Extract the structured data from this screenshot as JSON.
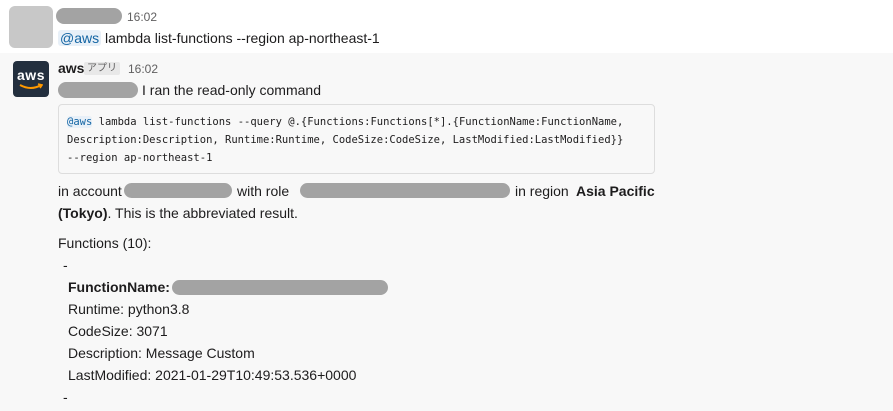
{
  "message1": {
    "time": "16:02",
    "mention": "@aws",
    "command_text": " lambda list-functions --region ap-northeast-1"
  },
  "message2": {
    "sender": "aws",
    "badge": "アプリ",
    "time": "16:02",
    "intro": "I ran the read-only command",
    "code": {
      "mention": "@aws",
      "line1_rest": " lambda list-functions --query @.{Functions:Functions[*].{FunctionName:FunctionName,",
      "line2": "Description:Description, Runtime:Runtime, CodeSize:CodeSize, LastModified:LastModified}}",
      "line3": "--region ap-northeast-1"
    },
    "account_prefix": "in account",
    "role_text": "with role",
    "region_text": "in region",
    "region_bold_1": "Asia Pacific",
    "region_bold_2": "(Tokyo)",
    "abbrev_text": ". This is the abbreviated result.",
    "functions_header": "Functions (10):",
    "dash": "-",
    "fn_name_label": "FunctionName:",
    "runtime": "Runtime: python3.8",
    "code_size": "CodeSize: 3071",
    "description": "Description: Message Custom",
    "last_modified": "LastModified: 2021-01-29T10:49:53.536+0000"
  }
}
